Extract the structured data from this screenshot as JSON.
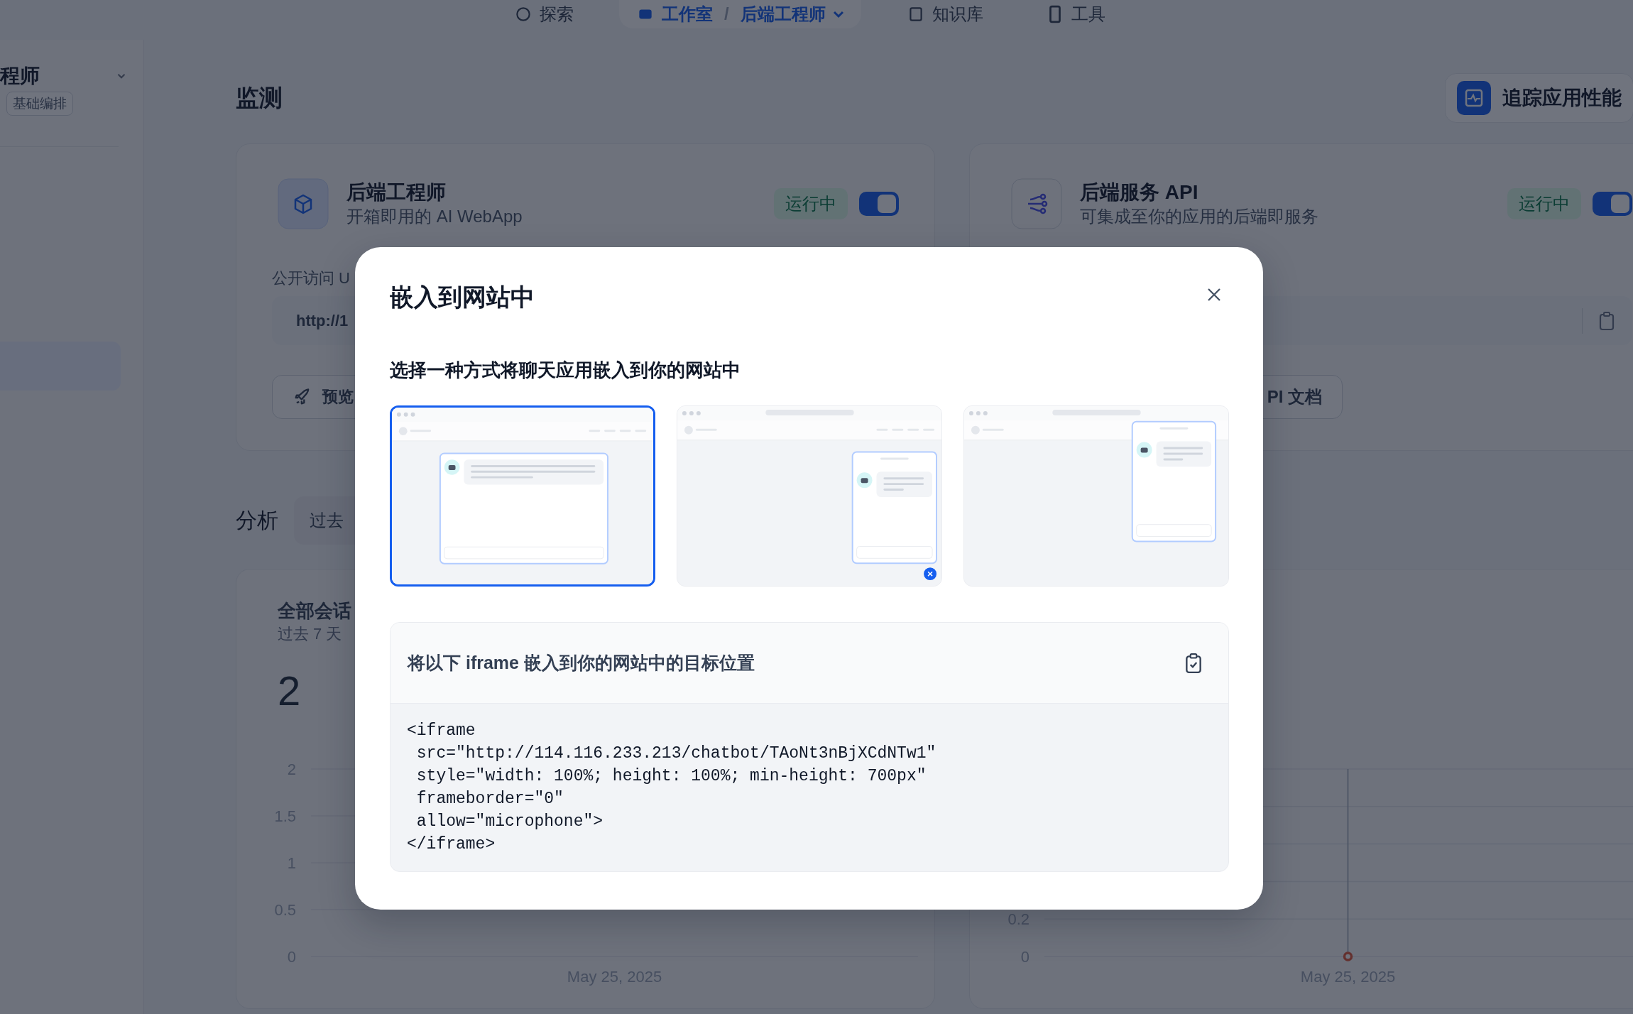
{
  "top_nav": [
    {
      "kind": "explore",
      "label": "探索",
      "selected": false
    },
    {
      "kind": "studio",
      "label": "工作室",
      "separator": "/",
      "current": "后端工程师",
      "selected": true
    },
    {
      "kind": "knowledge",
      "label": "知识库",
      "selected": false
    },
    {
      "kind": "tools",
      "label": "工具",
      "selected": false
    }
  ],
  "sidebar": {
    "app_name": "程师",
    "tag": "基础编排"
  },
  "monitor": {
    "title": "监测",
    "trace_button": "追踪应用性能",
    "cards": [
      {
        "kind": "webapp",
        "title": "后端工程师",
        "subtitle": "开箱即用的 AI WebApp",
        "status": "运行中",
        "on": true,
        "url_label": "公开访问 U",
        "url": "http://1",
        "button": "预览"
      },
      {
        "kind": "api",
        "title": "后端服务 API",
        "subtitle": "可集成至你的应用的后端即服务",
        "status": "运行中",
        "on": true,
        "copy_icon": true,
        "button": "PI 文档"
      }
    ]
  },
  "analysis": {
    "title": "分析",
    "period": "过去",
    "charts": [
      {
        "title": "全部会话",
        "subtitle": "过去 7 天",
        "total": "2",
        "chart_data": {
          "type": "line",
          "categories": [
            "May 25, 2025"
          ],
          "ylim": [
            0,
            2
          ],
          "yticks": [
            0,
            0.5,
            1,
            1.5,
            2
          ],
          "grid": true
        }
      },
      {
        "chart_data": {
          "type": "line",
          "categories": [
            "May 25, 2025"
          ],
          "ylim": [
            0,
            1
          ],
          "yticks": [
            0,
            0.2
          ],
          "grid": true,
          "ref_lines": [
            {
              "axis": "x",
              "value": "May 25, 2025"
            }
          ],
          "series": [
            {
              "color": "#e0583a",
              "values": [
                0
              ],
              "marker": "circle"
            }
          ]
        }
      }
    ]
  },
  "modal": {
    "title": "嵌入到网站中",
    "subtitle": "选择一种方式将聊天应用嵌入到你的网站中",
    "options": [
      {
        "kind": "full",
        "selected": true
      },
      {
        "kind": "bubble",
        "selected": false
      },
      {
        "kind": "corner",
        "selected": false
      }
    ],
    "code_label": "将以下 iframe 嵌入到你的网站中的目标位置",
    "code": "<iframe\n src=\"http://114.116.233.213/chatbot/TAoNt3nBjXCdNTw1\"\n style=\"width: 100%; height: 100%; min-height: 700px\"\n frameborder=\"0\"\n allow=\"microphone\">\n</iframe>"
  }
}
